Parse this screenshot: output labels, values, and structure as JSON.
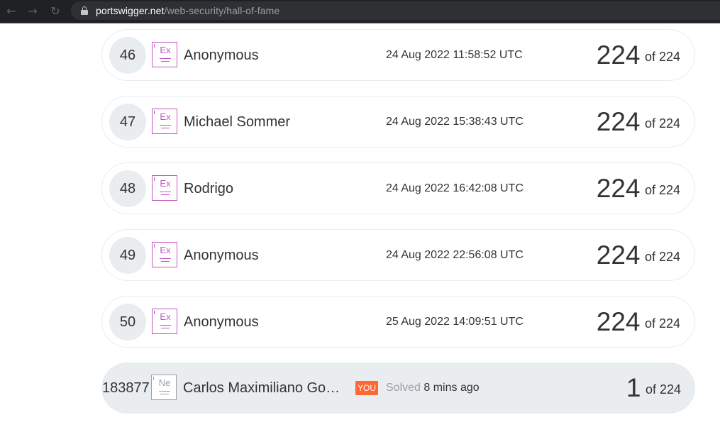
{
  "browser": {
    "back_icon": "arrow-left-icon",
    "forward_icon": "arrow-right-icon",
    "reload_icon": "reload-icon",
    "url_domain": "portswigger.net",
    "url_path": "/web-security/hall-of-fame"
  },
  "leaderboard": {
    "rows": [
      {
        "rank": "46",
        "level": "Ex",
        "name": "Anonymous",
        "date": "24 Aug 2022 11:58:52 UTC",
        "score": "224",
        "total": "of 224"
      },
      {
        "rank": "47",
        "level": "Ex",
        "name": "Michael Sommer",
        "date": "24 Aug 2022 15:38:43 UTC",
        "score": "224",
        "total": "of 224"
      },
      {
        "rank": "48",
        "level": "Ex",
        "name": "Rodrigo",
        "date": "24 Aug 2022 16:42:08 UTC",
        "score": "224",
        "total": "of 224"
      },
      {
        "rank": "49",
        "level": "Ex",
        "name": "Anonymous",
        "date": "24 Aug 2022 22:56:08 UTC",
        "score": "224",
        "total": "of 224"
      },
      {
        "rank": "50",
        "level": "Ex",
        "name": "Anonymous",
        "date": "25 Aug 2022 14:09:51 UTC",
        "score": "224",
        "total": "of 224"
      }
    ],
    "current_user": {
      "rank": "183877",
      "level": "Ne",
      "name": "Carlos Maximiliano Go…",
      "you_label": "YOU",
      "solved_label": "Solved",
      "solved_time": "8 mins ago",
      "score": "1",
      "total": "of 224"
    }
  },
  "colors": {
    "expert_badge": "#c056c0",
    "novice_badge": "#9aa0a6",
    "you_badge": "#ff6633",
    "current_row_bg": "#e9edf0"
  }
}
